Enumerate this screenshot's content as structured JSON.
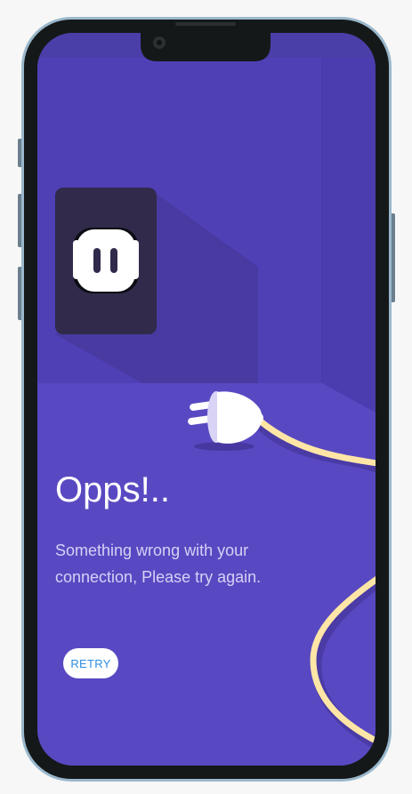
{
  "screen": {
    "heading": "Opps!..",
    "message": "Something wrong with your connection, Please try again.",
    "retry_label": "RETRY"
  },
  "colors": {
    "background": "#5849c2",
    "wall": "#4f40b6",
    "socket_plate": "#312a4a",
    "cable": "#ffe6a6",
    "button_text": "#2f8fe3"
  },
  "icons": [
    "front-camera-icon",
    "power-socket-icon",
    "plug-icon",
    "cable-icon"
  ]
}
